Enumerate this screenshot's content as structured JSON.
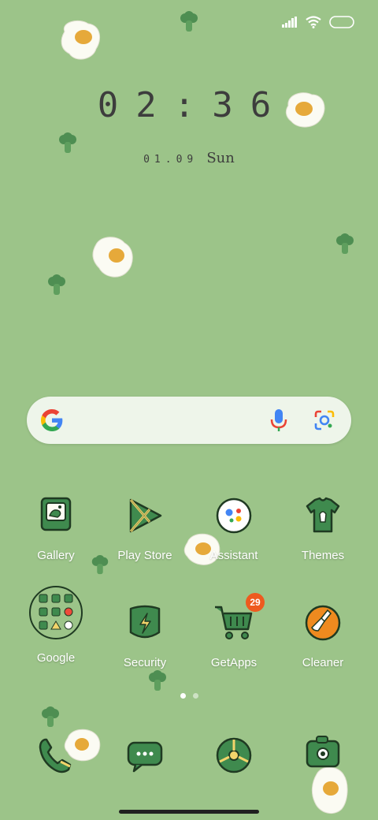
{
  "status": {
    "signal_icon": "signal-icon",
    "wifi_icon": "wifi-icon",
    "battery_icon": "battery-icon"
  },
  "clock": {
    "time": "02:36",
    "date": "01.09",
    "day": "Sun"
  },
  "search": {
    "logo": "google-logo",
    "mic_icon": "mic-icon",
    "lens_icon": "lens-icon"
  },
  "apps": [
    {
      "label": "Gallery",
      "icon": "gallery-icon"
    },
    {
      "label": "Play Store",
      "icon": "play-store-icon"
    },
    {
      "label": "Assistant",
      "icon": "assistant-icon"
    },
    {
      "label": "Themes",
      "icon": "themes-icon"
    },
    {
      "label": "Google",
      "icon": "google-folder-icon"
    },
    {
      "label": "Security",
      "icon": "security-icon"
    },
    {
      "label": "GetApps",
      "icon": "getapps-icon",
      "badge": "29"
    },
    {
      "label": "Cleaner",
      "icon": "cleaner-icon"
    }
  ],
  "dock": [
    {
      "icon": "phone-icon"
    },
    {
      "icon": "messages-icon"
    },
    {
      "icon": "browser-icon"
    },
    {
      "icon": "camera-icon"
    }
  ],
  "colors": {
    "background": "#9cc489",
    "icon_green": "#3f8a4e",
    "outline": "#1f3a22",
    "badge": "#ee5a1f",
    "accent_yellow": "#f2d46b"
  }
}
